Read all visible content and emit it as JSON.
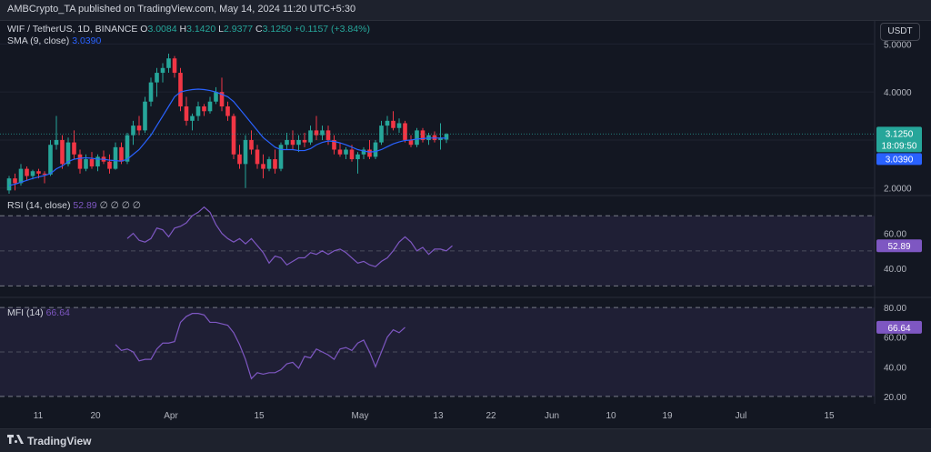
{
  "publisher_line": "AMBCrypto_TA published on TradingView.com, May 14, 2024 11:20 UTC+5:30",
  "currency": "USDT",
  "legend": {
    "symbol": "WIF / TetherUS, 1D, BINANCE",
    "ohlc": [
      {
        "k": "O",
        "v": "3.0084"
      },
      {
        "k": "H",
        "v": "3.1420"
      },
      {
        "k": "L",
        "v": "2.9377"
      },
      {
        "k": "C",
        "v": "3.1250"
      }
    ],
    "change": "+0.1157 (+3.84%)",
    "sma_label": "SMA (9, close)",
    "sma_value": "3.0390",
    "rsi_label": "RSI (14, close)",
    "rsi_value": "52.89",
    "rsi_placeholders": "∅ ∅ ∅ ∅",
    "mfi_label": "MFI (14)",
    "mfi_value": "66.64"
  },
  "price_tags": {
    "price": "3.1250",
    "countdown": "18:09:50",
    "sma": "3.0390",
    "rsi": "52.89",
    "mfi": "66.64"
  },
  "footer": {
    "brand": "TradingView"
  },
  "colors": {
    "up": "#26a69a",
    "down": "#f23645",
    "sma": "#2962ff",
    "osc": "#7e57c2",
    "background": "#131722"
  },
  "chart_data": {
    "type": "candlestick",
    "x_tick_labels": [
      "11",
      "20",
      "Apr",
      "15",
      "May",
      "13",
      "22",
      "Jun",
      "10",
      "19",
      "Jul",
      "15"
    ],
    "price_axis": {
      "ticks": [
        "2.0000",
        "3.0000",
        "4.0000",
        "5.0000"
      ],
      "ylim": [
        1.9,
        5.5
      ]
    },
    "candles": [
      {
        "o": 1.95,
        "h": 2.25,
        "l": 1.88,
        "c": 2.2
      },
      {
        "o": 2.2,
        "h": 2.3,
        "l": 1.95,
        "c": 2.1
      },
      {
        "o": 2.1,
        "h": 2.5,
        "l": 2.05,
        "c": 2.4
      },
      {
        "o": 2.4,
        "h": 2.45,
        "l": 2.15,
        "c": 2.25
      },
      {
        "o": 2.25,
        "h": 2.38,
        "l": 2.18,
        "c": 2.35
      },
      {
        "o": 2.35,
        "h": 2.4,
        "l": 2.2,
        "c": 2.3
      },
      {
        "o": 2.3,
        "h": 2.35,
        "l": 2.1,
        "c": 2.28
      },
      {
        "o": 2.28,
        "h": 3.0,
        "l": 2.25,
        "c": 2.9
      },
      {
        "o": 2.9,
        "h": 3.5,
        "l": 2.8,
        "c": 3.0
      },
      {
        "o": 3.0,
        "h": 3.1,
        "l": 2.4,
        "c": 2.5
      },
      {
        "o": 2.5,
        "h": 3.05,
        "l": 2.45,
        "c": 2.95
      },
      {
        "o": 2.95,
        "h": 3.2,
        "l": 2.6,
        "c": 2.7
      },
      {
        "o": 2.7,
        "h": 2.8,
        "l": 2.3,
        "c": 2.4
      },
      {
        "o": 2.4,
        "h": 2.7,
        "l": 2.35,
        "c": 2.6
      },
      {
        "o": 2.6,
        "h": 2.75,
        "l": 2.4,
        "c": 2.45
      },
      {
        "o": 2.45,
        "h": 2.7,
        "l": 2.35,
        "c": 2.65
      },
      {
        "o": 2.65,
        "h": 2.78,
        "l": 2.5,
        "c": 2.55
      },
      {
        "o": 2.55,
        "h": 2.7,
        "l": 2.3,
        "c": 2.4
      },
      {
        "o": 2.4,
        "h": 2.95,
        "l": 2.38,
        "c": 2.85
      },
      {
        "o": 2.85,
        "h": 2.95,
        "l": 2.5,
        "c": 2.55
      },
      {
        "o": 2.55,
        "h": 3.15,
        "l": 2.5,
        "c": 3.1
      },
      {
        "o": 3.1,
        "h": 3.4,
        "l": 2.9,
        "c": 3.3
      },
      {
        "o": 3.3,
        "h": 3.5,
        "l": 3.1,
        "c": 3.2
      },
      {
        "o": 3.2,
        "h": 3.9,
        "l": 3.15,
        "c": 3.8
      },
      {
        "o": 3.8,
        "h": 4.3,
        "l": 3.7,
        "c": 4.2
      },
      {
        "o": 4.2,
        "h": 4.5,
        "l": 3.9,
        "c": 4.4
      },
      {
        "o": 4.4,
        "h": 4.6,
        "l": 4.2,
        "c": 4.5
      },
      {
        "o": 4.5,
        "h": 4.8,
        "l": 4.4,
        "c": 4.7
      },
      {
        "o": 4.7,
        "h": 4.75,
        "l": 4.3,
        "c": 4.4
      },
      {
        "o": 4.4,
        "h": 4.5,
        "l": 3.6,
        "c": 3.7
      },
      {
        "o": 3.7,
        "h": 3.9,
        "l": 3.3,
        "c": 3.4
      },
      {
        "o": 3.4,
        "h": 3.55,
        "l": 3.2,
        "c": 3.5
      },
      {
        "o": 3.5,
        "h": 3.8,
        "l": 3.4,
        "c": 3.7
      },
      {
        "o": 3.7,
        "h": 3.75,
        "l": 3.5,
        "c": 3.6
      },
      {
        "o": 3.6,
        "h": 3.9,
        "l": 3.55,
        "c": 3.8
      },
      {
        "o": 3.8,
        "h": 4.1,
        "l": 3.75,
        "c": 4.0
      },
      {
        "o": 4.0,
        "h": 4.3,
        "l": 3.6,
        "c": 3.7
      },
      {
        "o": 3.7,
        "h": 3.8,
        "l": 3.4,
        "c": 3.5
      },
      {
        "o": 3.5,
        "h": 3.55,
        "l": 2.6,
        "c": 2.7
      },
      {
        "o": 2.7,
        "h": 2.9,
        "l": 2.4,
        "c": 2.5
      },
      {
        "o": 2.5,
        "h": 3.1,
        "l": 2.0,
        "c": 3.0
      },
      {
        "o": 3.0,
        "h": 3.2,
        "l": 2.7,
        "c": 2.8
      },
      {
        "o": 2.8,
        "h": 2.9,
        "l": 2.4,
        "c": 2.5
      },
      {
        "o": 2.5,
        "h": 2.7,
        "l": 2.2,
        "c": 2.4
      },
      {
        "o": 2.4,
        "h": 2.65,
        "l": 2.35,
        "c": 2.6
      },
      {
        "o": 2.6,
        "h": 2.8,
        "l": 2.3,
        "c": 2.4
      },
      {
        "o": 2.4,
        "h": 2.95,
        "l": 2.35,
        "c": 2.9
      },
      {
        "o": 2.9,
        "h": 3.15,
        "l": 2.8,
        "c": 3.0
      },
      {
        "o": 3.0,
        "h": 3.2,
        "l": 2.8,
        "c": 2.9
      },
      {
        "o": 2.9,
        "h": 3.1,
        "l": 2.75,
        "c": 3.0
      },
      {
        "o": 3.0,
        "h": 3.15,
        "l": 2.85,
        "c": 2.95
      },
      {
        "o": 2.95,
        "h": 3.3,
        "l": 2.9,
        "c": 3.2
      },
      {
        "o": 3.2,
        "h": 3.5,
        "l": 3.0,
        "c": 3.1
      },
      {
        "o": 3.1,
        "h": 3.3,
        "l": 3.0,
        "c": 3.2
      },
      {
        "o": 3.2,
        "h": 3.3,
        "l": 2.9,
        "c": 3.0
      },
      {
        "o": 3.0,
        "h": 3.1,
        "l": 2.7,
        "c": 2.8
      },
      {
        "o": 2.8,
        "h": 2.95,
        "l": 2.65,
        "c": 2.7
      },
      {
        "o": 2.7,
        "h": 2.85,
        "l": 2.6,
        "c": 2.8
      },
      {
        "o": 2.8,
        "h": 2.9,
        "l": 2.55,
        "c": 2.6
      },
      {
        "o": 2.6,
        "h": 2.75,
        "l": 2.3,
        "c": 2.7
      },
      {
        "o": 2.7,
        "h": 2.85,
        "l": 2.6,
        "c": 2.8
      },
      {
        "o": 2.8,
        "h": 3.0,
        "l": 2.6,
        "c": 2.65
      },
      {
        "o": 2.65,
        "h": 3.0,
        "l": 2.6,
        "c": 2.95
      },
      {
        "o": 2.95,
        "h": 3.4,
        "l": 2.9,
        "c": 3.3
      },
      {
        "o": 3.3,
        "h": 3.5,
        "l": 3.1,
        "c": 3.4
      },
      {
        "o": 3.4,
        "h": 3.6,
        "l": 3.2,
        "c": 3.25
      },
      {
        "o": 3.25,
        "h": 3.45,
        "l": 3.15,
        "c": 3.35
      },
      {
        "o": 3.35,
        "h": 3.4,
        "l": 2.95,
        "c": 3.0
      },
      {
        "o": 3.0,
        "h": 3.1,
        "l": 2.85,
        "c": 2.9
      },
      {
        "o": 2.9,
        "h": 3.25,
        "l": 2.85,
        "c": 3.2
      },
      {
        "o": 3.2,
        "h": 3.25,
        "l": 2.95,
        "c": 3.0
      },
      {
        "o": 3.0,
        "h": 3.15,
        "l": 2.9,
        "c": 3.1
      },
      {
        "o": 3.1,
        "h": 3.18,
        "l": 2.95,
        "c": 3.0
      },
      {
        "o": 3.0,
        "h": 3.35,
        "l": 2.8,
        "c": 3.05
      },
      {
        "o": 3.0084,
        "h": 3.142,
        "l": 2.9377,
        "c": 3.125
      }
    ],
    "sma": [
      2.05,
      2.08,
      2.12,
      2.16,
      2.2,
      2.23,
      2.26,
      2.3,
      2.4,
      2.46,
      2.55,
      2.6,
      2.62,
      2.63,
      2.62,
      2.6,
      2.6,
      2.58,
      2.57,
      2.56,
      2.6,
      2.7,
      2.8,
      2.95,
      3.1,
      3.3,
      3.5,
      3.7,
      3.9,
      4.0,
      4.03,
      4.05,
      4.06,
      4.05,
      4.03,
      4.0,
      3.95,
      3.9,
      3.8,
      3.65,
      3.5,
      3.35,
      3.2,
      3.05,
      2.95,
      2.85,
      2.8,
      2.8,
      2.8,
      2.78,
      2.78,
      2.82,
      2.9,
      2.95,
      2.98,
      2.97,
      2.94,
      2.9,
      2.85,
      2.8,
      2.77,
      2.75,
      2.76,
      2.8,
      2.86,
      2.92,
      2.96,
      2.99,
      3.0,
      3.02,
      3.03,
      3.04,
      3.04,
      3.04,
      3.039
    ],
    "rsi": {
      "ticks": [
        "40.00",
        "60.00"
      ],
      "band": [
        30,
        70
      ],
      "mid": 50,
      "ylim": [
        25,
        80
      ],
      "first_index": 20,
      "values": [
        57,
        60,
        56,
        55,
        57,
        63,
        62,
        58,
        63,
        64,
        66,
        70,
        72,
        75,
        72,
        65,
        60,
        57,
        55,
        57,
        54,
        57,
        53,
        49,
        43,
        47,
        46,
        42,
        44,
        46,
        46,
        49,
        48,
        50,
        48,
        50,
        51,
        49,
        46,
        43,
        44,
        42,
        41,
        44,
        46,
        50,
        55,
        58,
        55,
        50,
        52,
        48,
        51,
        51,
        50,
        52.89
      ]
    },
    "mfi": {
      "ticks": [
        "20.00",
        "40.00",
        "60.00",
        "80.00"
      ],
      "band": [
        20,
        80
      ],
      "mid": 50,
      "ylim": [
        15,
        85
      ],
      "first_index": 18,
      "values": [
        55,
        51,
        52,
        50,
        44,
        45,
        45,
        52,
        56,
        56,
        57,
        70,
        74,
        76,
        76,
        75,
        70,
        70,
        69,
        68,
        63,
        55,
        45,
        32,
        36,
        35,
        36,
        36,
        38,
        42,
        43,
        39,
        47,
        46,
        52,
        50,
        48,
        45,
        52,
        53,
        51,
        56,
        58,
        50,
        40,
        50,
        60,
        65,
        63,
        66.64
      ]
    }
  }
}
